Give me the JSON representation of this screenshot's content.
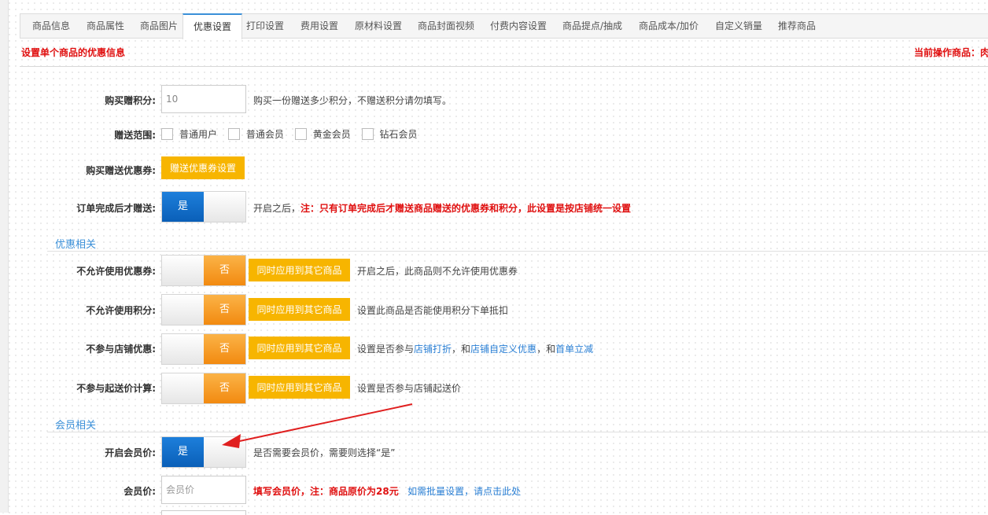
{
  "tabs": [
    {
      "label": "商品信息"
    },
    {
      "label": "商品属性"
    },
    {
      "label": "商品图片"
    },
    {
      "label": "优惠设置",
      "active": true
    },
    {
      "label": "打印设置"
    },
    {
      "label": "费用设置"
    },
    {
      "label": "原材料设置"
    },
    {
      "label": "商品封面视频"
    },
    {
      "label": "付费内容设置"
    },
    {
      "label": "商品提点/抽成"
    },
    {
      "label": "商品成本/加价"
    },
    {
      "label": "自定义销量"
    },
    {
      "label": "推荐商品"
    }
  ],
  "header": {
    "description": "设置单个商品的优惠信息",
    "current_product": "当前操作商品：肉"
  },
  "points": {
    "label": "购买赠积分:",
    "value": "10",
    "hint": "购买一份赠送多少积分，不赠送积分请勿填写。"
  },
  "scope": {
    "label": "赠送范围:",
    "options": [
      "普通用户",
      "普通会员",
      "黄金会员",
      "钻石会员"
    ]
  },
  "coupon_gift": {
    "label": "购买赠送优惠券:",
    "button": "赠送优惠券设置"
  },
  "order_complete": {
    "label": "订单完成后才赠送:",
    "state": "是",
    "hint_prefix": "开启之后，",
    "hint_note": "注：只有订单完成后才赠送商品赠送的优惠券和积分，此设置是按店铺统一设置"
  },
  "discount_section": {
    "title": "优惠相关",
    "apply_all_label": "同时应用到其它商品",
    "rows": [
      {
        "label": "不允许使用优惠券:",
        "state": "否",
        "hint": "开启之后，此商品则不允许使用优惠券"
      },
      {
        "label": "不允许使用积分:",
        "state": "否",
        "hint": "设置此商品是否能使用积分下单抵扣"
      },
      {
        "label": "不参与店铺优惠:",
        "state": "否",
        "hint_prefix": "设置是否参与",
        "link1": "店铺打折",
        "sep1": "，和",
        "link2": "店铺自定义优惠",
        "sep2": "，和",
        "link3": "首单立减"
      },
      {
        "label": "不参与起送价计算:",
        "state": "否",
        "hint": "设置是否参与店铺起送价"
      }
    ]
  },
  "member_section": {
    "title": "会员相关",
    "enable": {
      "label": "开启会员价:",
      "state": "是",
      "hint": "是否需要会员价，需要则选择“是”"
    },
    "price": {
      "label": "会员价:",
      "placeholder": "会员价",
      "note": "填写会员价，注：商品原价为28元",
      "link": "如需批量设置，请点击此处"
    }
  },
  "colors": {
    "accent": "#3a8fd8",
    "toggle_on": "#0a5fb8",
    "toggle_off": "#f28a10",
    "button": "#f7b500",
    "note": "#e01010",
    "annotation_arrow": "#e02020"
  }
}
